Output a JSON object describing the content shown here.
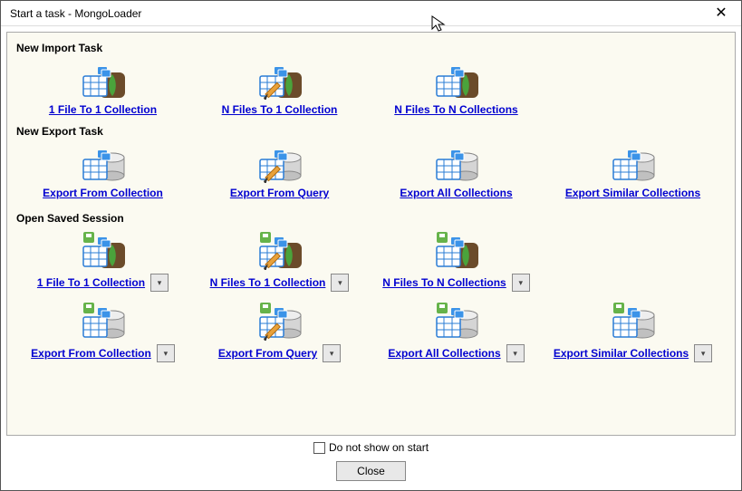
{
  "window": {
    "title": "Start a task - MongoLoader"
  },
  "sections": {
    "import_title": "New Import Task",
    "export_title": "New Export Task",
    "session_title": "Open Saved Session"
  },
  "import": {
    "one_to_one": "1 File To 1 Collection",
    "n_to_one": "N Files To 1 Collection",
    "n_to_n": "N Files To N Collections"
  },
  "export": {
    "from_collection": "Export From Collection",
    "from_query": "Export From Query",
    "all_collections": "Export All Collections",
    "similar": "Export Similar Collections"
  },
  "session": {
    "one_to_one": "1 File To 1 Collection",
    "n_to_one": "N Files To 1 Collection",
    "n_to_n": "N Files To N  Collections",
    "from_collection": "Export From Collection",
    "from_query": "Export From Query",
    "all_collections": "Export All Collections",
    "similar": "Export Similar Collections"
  },
  "footer": {
    "dont_show": "Do not show on start",
    "close": "Close"
  }
}
